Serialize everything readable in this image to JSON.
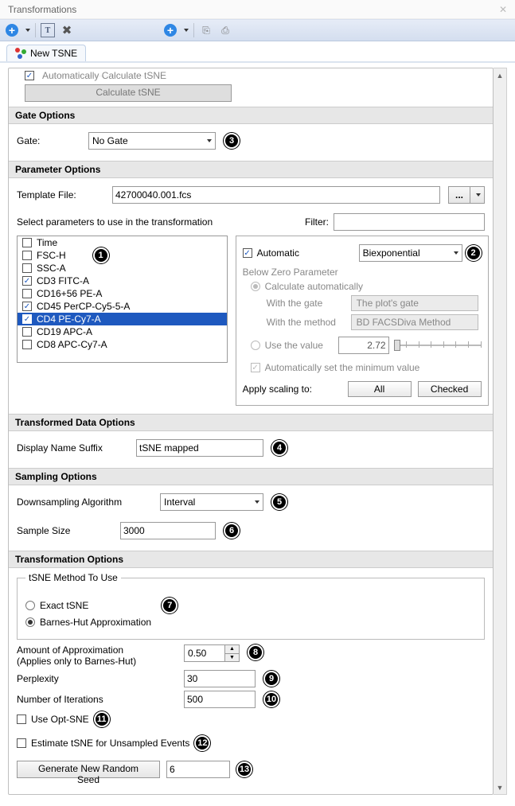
{
  "window": {
    "title": "Transformations"
  },
  "tab": {
    "label": "New TSNE"
  },
  "top": {
    "auto_calc_label": "Automatically Calculate tSNE",
    "calc_button": "Calculate tSNE"
  },
  "gate_options": {
    "header": "Gate Options",
    "gate_label": "Gate:",
    "gate_value": "No Gate"
  },
  "parameter_options": {
    "header": "Parameter Options",
    "template_file_label": "Template File:",
    "template_file_value": "42700040.001.fcs",
    "more_button": "...",
    "select_params_label": "Select parameters to use in the transformation",
    "filter_label": "Filter:",
    "filter_value": "",
    "params": [
      {
        "label": "Time",
        "checked": false,
        "selected": false
      },
      {
        "label": "FSC-H",
        "checked": false,
        "selected": false
      },
      {
        "label": "SSC-A",
        "checked": false,
        "selected": false
      },
      {
        "label": "CD3 FITC-A",
        "checked": true,
        "selected": false
      },
      {
        "label": "CD16+56 PE-A",
        "checked": false,
        "selected": false
      },
      {
        "label": "CD45 PerCP-Cy5-5-A",
        "checked": true,
        "selected": false
      },
      {
        "label": "CD4 PE-Cy7-A",
        "checked": true,
        "selected": true
      },
      {
        "label": "CD19 APC-A",
        "checked": false,
        "selected": false
      },
      {
        "label": "CD8 APC-Cy7-A",
        "checked": false,
        "selected": false
      }
    ],
    "scaling": {
      "automatic_label": "Automatic",
      "automatic_checked": true,
      "scaling_type": "Biexponential",
      "below_zero_header": "Below Zero Parameter",
      "calc_auto_label": "Calculate automatically",
      "with_gate_label": "With the gate",
      "with_gate_value": "The plot's gate",
      "with_method_label": "With the method",
      "with_method_value": "BD FACSDiva Method",
      "use_value_label": "Use the value",
      "use_value_value": "2.72",
      "auto_min_label": "Automatically set the minimum value",
      "apply_label": "Apply scaling to:",
      "apply_all": "All",
      "apply_checked": "Checked"
    }
  },
  "transformed_data": {
    "header": "Transformed Data Options",
    "suffix_label": "Display Name Suffix",
    "suffix_value": "tSNE mapped"
  },
  "sampling": {
    "header": "Sampling Options",
    "algo_label": "Downsampling Algorithm",
    "algo_value": "Interval",
    "size_label": "Sample Size",
    "size_value": "3000"
  },
  "transformation": {
    "header": "Transformation Options",
    "method_title": "tSNE Method To Use",
    "exact_label": "Exact tSNE",
    "barnes_label": "Barnes-Hut Approximation",
    "approx_label1": "Amount of Approximation",
    "approx_label2": "(Applies only to Barnes-Hut)",
    "approx_value": "0.50",
    "perplexity_label": "Perplexity",
    "perplexity_value": "30",
    "iterations_label": "Number of Iterations",
    "iterations_value": "500",
    "use_optsne_label": "Use Opt-SNE",
    "estimate_unsampled_label": "Estimate tSNE for Unsampled Events",
    "seed_button": "Generate New Random Seed",
    "seed_value": "6"
  },
  "callouts": {
    "c1": "1",
    "c2": "2",
    "c3": "3",
    "c4": "4",
    "c5": "5",
    "c6": "6",
    "c7": "7",
    "c8": "8",
    "c9": "9",
    "c10": "10",
    "c11": "11",
    "c12": "12",
    "c13": "13"
  }
}
